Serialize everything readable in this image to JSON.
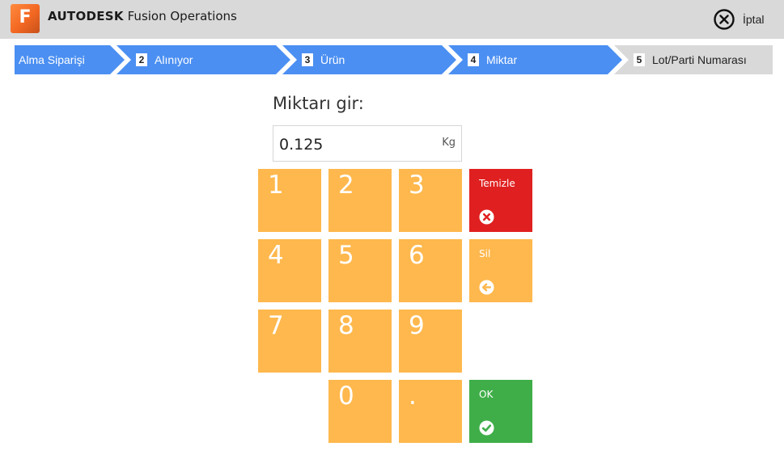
{
  "header": {
    "brand_bold": "AUTODESK",
    "brand_rest": "Fusion Operations",
    "logo_letter": "F",
    "cancel_label": "İptal",
    "cancel_icon": "close-circle-icon"
  },
  "steps": [
    {
      "num": "",
      "label": "Alma Siparişi",
      "state": "done"
    },
    {
      "num": "2",
      "label": "Alınıyor",
      "state": "done"
    },
    {
      "num": "3",
      "label": "Ürün",
      "state": "done"
    },
    {
      "num": "4",
      "label": "Miktar",
      "state": "current"
    },
    {
      "num": "5",
      "label": "Lot/Parti Numarası",
      "state": "todo"
    }
  ],
  "colors": {
    "step_active": "#4b8ff2",
    "step_inactive": "#d9d9d9",
    "key": "#ffb84d",
    "clear": "#e02020",
    "ok": "#3fae49"
  },
  "form": {
    "prompt": "Miktarı gir:",
    "value": "0.125",
    "unit": "Kg"
  },
  "keypad": {
    "digits": [
      "1",
      "2",
      "3",
      "4",
      "5",
      "6",
      "7",
      "8",
      "9",
      "0",
      "."
    ],
    "clear_label": "Temizle",
    "clear_icon": "x-circle-icon",
    "delete_label": "Sil",
    "delete_icon": "arrow-left-circle-icon",
    "ok_label": "OK",
    "ok_icon": "check-circle-icon"
  }
}
